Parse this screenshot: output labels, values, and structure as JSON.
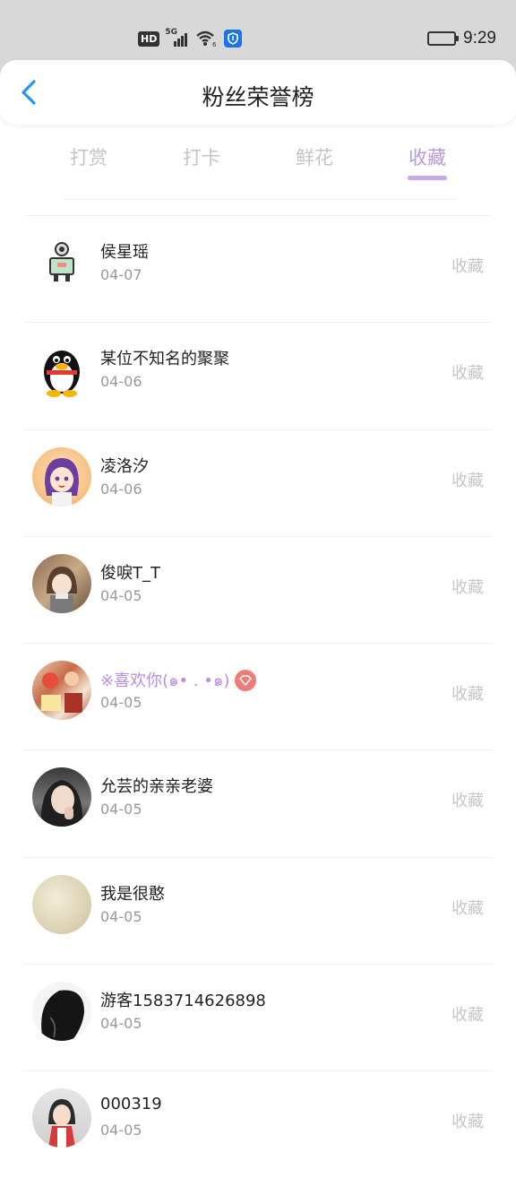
{
  "status_bar": {
    "hd_label": "HD",
    "network_label": "5G",
    "time": "9:29"
  },
  "header": {
    "title": "粉丝荣誉榜",
    "back_icon": "chevron-left-icon",
    "accent_color": "#2196f3"
  },
  "tabs": [
    {
      "label": "打赏",
      "active": false
    },
    {
      "label": "打卡",
      "active": false
    },
    {
      "label": "鲜花",
      "active": false
    },
    {
      "label": "收藏",
      "active": true
    }
  ],
  "tab_active_color": "#b99ad6",
  "fans": [
    {
      "name": "侯星瑶",
      "date": "04-07",
      "action": "收藏",
      "avatar": "robot-cartoon",
      "vip": false
    },
    {
      "name": "某位不知名的聚聚",
      "date": "04-06",
      "action": "收藏",
      "avatar": "penguin",
      "vip": false
    },
    {
      "name": "凌洛汐",
      "date": "04-06",
      "action": "收藏",
      "avatar": "anime-girl-purple",
      "vip": false
    },
    {
      "name": "俊唳T_T",
      "date": "04-05",
      "action": "收藏",
      "avatar": "anime-girl-library",
      "vip": false
    },
    {
      "name": "※喜欢你(๑• . •๑)",
      "date": "04-05",
      "action": "收藏",
      "avatar": "collage",
      "vip": true
    },
    {
      "name": "允芸的亲亲老婆",
      "date": "04-05",
      "action": "收藏",
      "avatar": "photo-woman",
      "vip": false
    },
    {
      "name": "我是很憨",
      "date": "04-05",
      "action": "收藏",
      "avatar": "blurry-beige",
      "vip": false
    },
    {
      "name": "游客1583714626898",
      "date": "04-05",
      "action": "收藏",
      "avatar": "dark-hair",
      "vip": false
    },
    {
      "name": "000319",
      "date": "04-05",
      "action": "收藏",
      "avatar": "girl-red-dress",
      "vip": false
    }
  ]
}
